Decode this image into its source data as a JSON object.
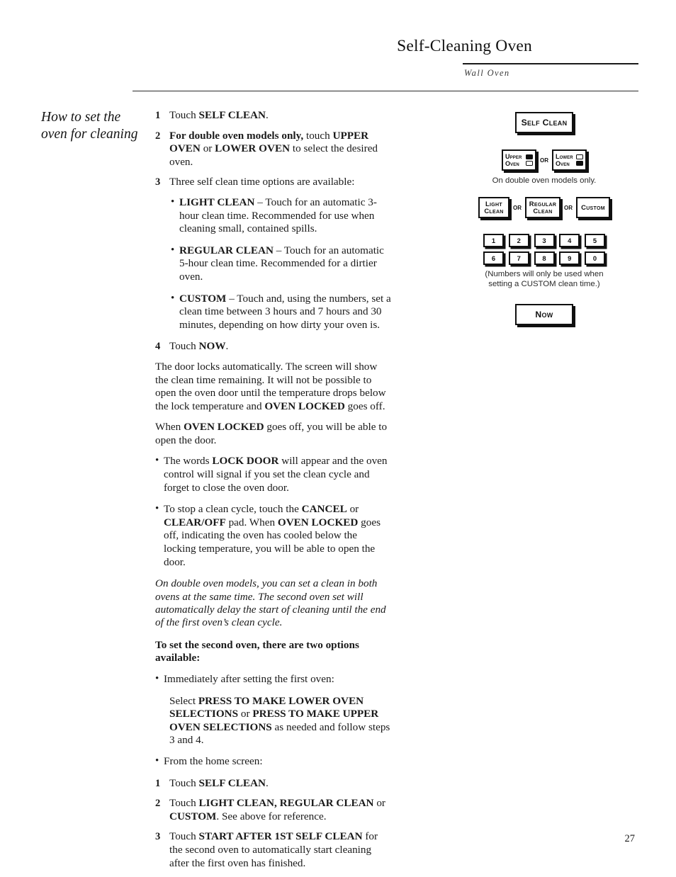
{
  "header": {
    "title": "Self-Cleaning Oven",
    "subtitle": "Wall Oven"
  },
  "sidebar": {
    "heading": "How to set the oven for cleaning"
  },
  "page": {
    "number": "27"
  },
  "content": {
    "step1_num": "1",
    "step1_text_pre": "Touch ",
    "step1_bold": "SELF CLEAN",
    "step1_text_post": ".",
    "step2_num": "2",
    "step2_bold_a": "For double oven models only,",
    "step2_text_a": " touch ",
    "step2_bold_b": "UPPER OVEN",
    "step2_text_b": " or ",
    "step2_bold_c": "LOWER OVEN",
    "step2_text_c": " to select the desired oven.",
    "step3_num": "3",
    "step3_text": "Three self clean time options are available:",
    "bullet_light_bold": "LIGHT CLEAN",
    "bullet_light_text": " – Touch for an automatic 3-hour clean time. Recommended for use when cleaning small, contained spills.",
    "bullet_regular_bold": "REGULAR CLEAN",
    "bullet_regular_text": " – Touch for an automatic 5-hour clean time. Recommended for a dirtier oven.",
    "bullet_custom_bold": "CUSTOM",
    "bullet_custom_text": " – Touch and, using the numbers, set a clean time between 3 hours and 7 hours and 30 minutes, depending on how dirty your oven is.",
    "step4_num": "4",
    "step4_text_pre": "Touch ",
    "step4_bold": "NOW",
    "step4_text_post": ".",
    "para_lock_a": "The door locks automatically. The screen will show the clean time remaining. It will not be possible to open the oven door until the temperature drops below the lock temperature and ",
    "para_lock_bold": "OVEN LOCKED",
    "para_lock_b": " goes off.",
    "para_unlock_a": "When ",
    "para_unlock_bold": "OVEN LOCKED",
    "para_unlock_b": " goes off, you will be able to open the door.",
    "bullet_lockdoor_a": "The words ",
    "bullet_lockdoor_bold": "LOCK DOOR",
    "bullet_lockdoor_b": " will appear and the oven control will signal if you set the clean cycle and forget to close the oven door.",
    "bullet_stop_a": "To stop a clean cycle, touch the ",
    "bullet_stop_bold_a": "CANCEL",
    "bullet_stop_b": " or ",
    "bullet_stop_bold_b": "CLEAR/OFF",
    "bullet_stop_c": " pad. When ",
    "bullet_stop_bold_c": "OVEN LOCKED",
    "bullet_stop_d": " goes off, indicating the oven has cooled below the locking temperature, you will be able to open the door.",
    "italic_note": "On double oven models, you can set a clean in both ovens at the same time. The second oven set will automatically delay the start of cleaning until the end of the first oven’s clean cycle.",
    "bold_second_oven": "To set the second oven, there are two options available:",
    "bullet_immediately": "Immediately after setting the first oven:",
    "select_text_a": "Select ",
    "select_bold_a": "PRESS TO MAKE LOWER OVEN SELECTIONS",
    "select_text_b": " or ",
    "select_bold_b": "PRESS TO MAKE UPPER OVEN SELECTIONS",
    "select_text_c": " as needed and follow steps 3 and 4.",
    "bullet_home_screen": "From the home screen:",
    "h1_num": "1",
    "h1_text_pre": "Touch ",
    "h1_bold": "SELF CLEAN",
    "h1_text_post": ".",
    "h2_num": "2",
    "h2_text_pre": "Touch ",
    "h2_bold_a": "LIGHT CLEAN, REGULAR CLEAN",
    "h2_text_mid": " or ",
    "h2_bold_b": "CUSTOM",
    "h2_text_post": ". See above for reference.",
    "h3_num": "3",
    "h3_text_pre": "Touch ",
    "h3_bold": "START AFTER 1ST SELF CLEAN",
    "h3_text_post": " for the second oven to automatically start cleaning after the first oven has finished."
  },
  "diagram": {
    "self_clean_button": "Self Clean",
    "upper_oven_line1": "Upper",
    "upper_oven_line2": "Oven",
    "lower_oven_line1": "Lower",
    "lower_oven_line2": "Oven",
    "or_label": "or",
    "double_oven_caption": "On double oven models only.",
    "light_clean_line1": "Light",
    "light_clean_line2": "Clean",
    "regular_clean_line1": "Regular",
    "regular_clean_line2": "Clean",
    "custom_button": "Custom",
    "numbers_row1": [
      "1",
      "2",
      "3",
      "4",
      "5"
    ],
    "numbers_row2": [
      "6",
      "7",
      "8",
      "9",
      "0"
    ],
    "numpad_caption_line1": "(Numbers will only be used when",
    "numpad_caption_line2": "setting a CUSTOM clean time.)",
    "now_button": "Now"
  },
  "colors": {
    "ink": "#1a1a1a",
    "rule": "#2b2b2b",
    "button_border": "#101010"
  }
}
